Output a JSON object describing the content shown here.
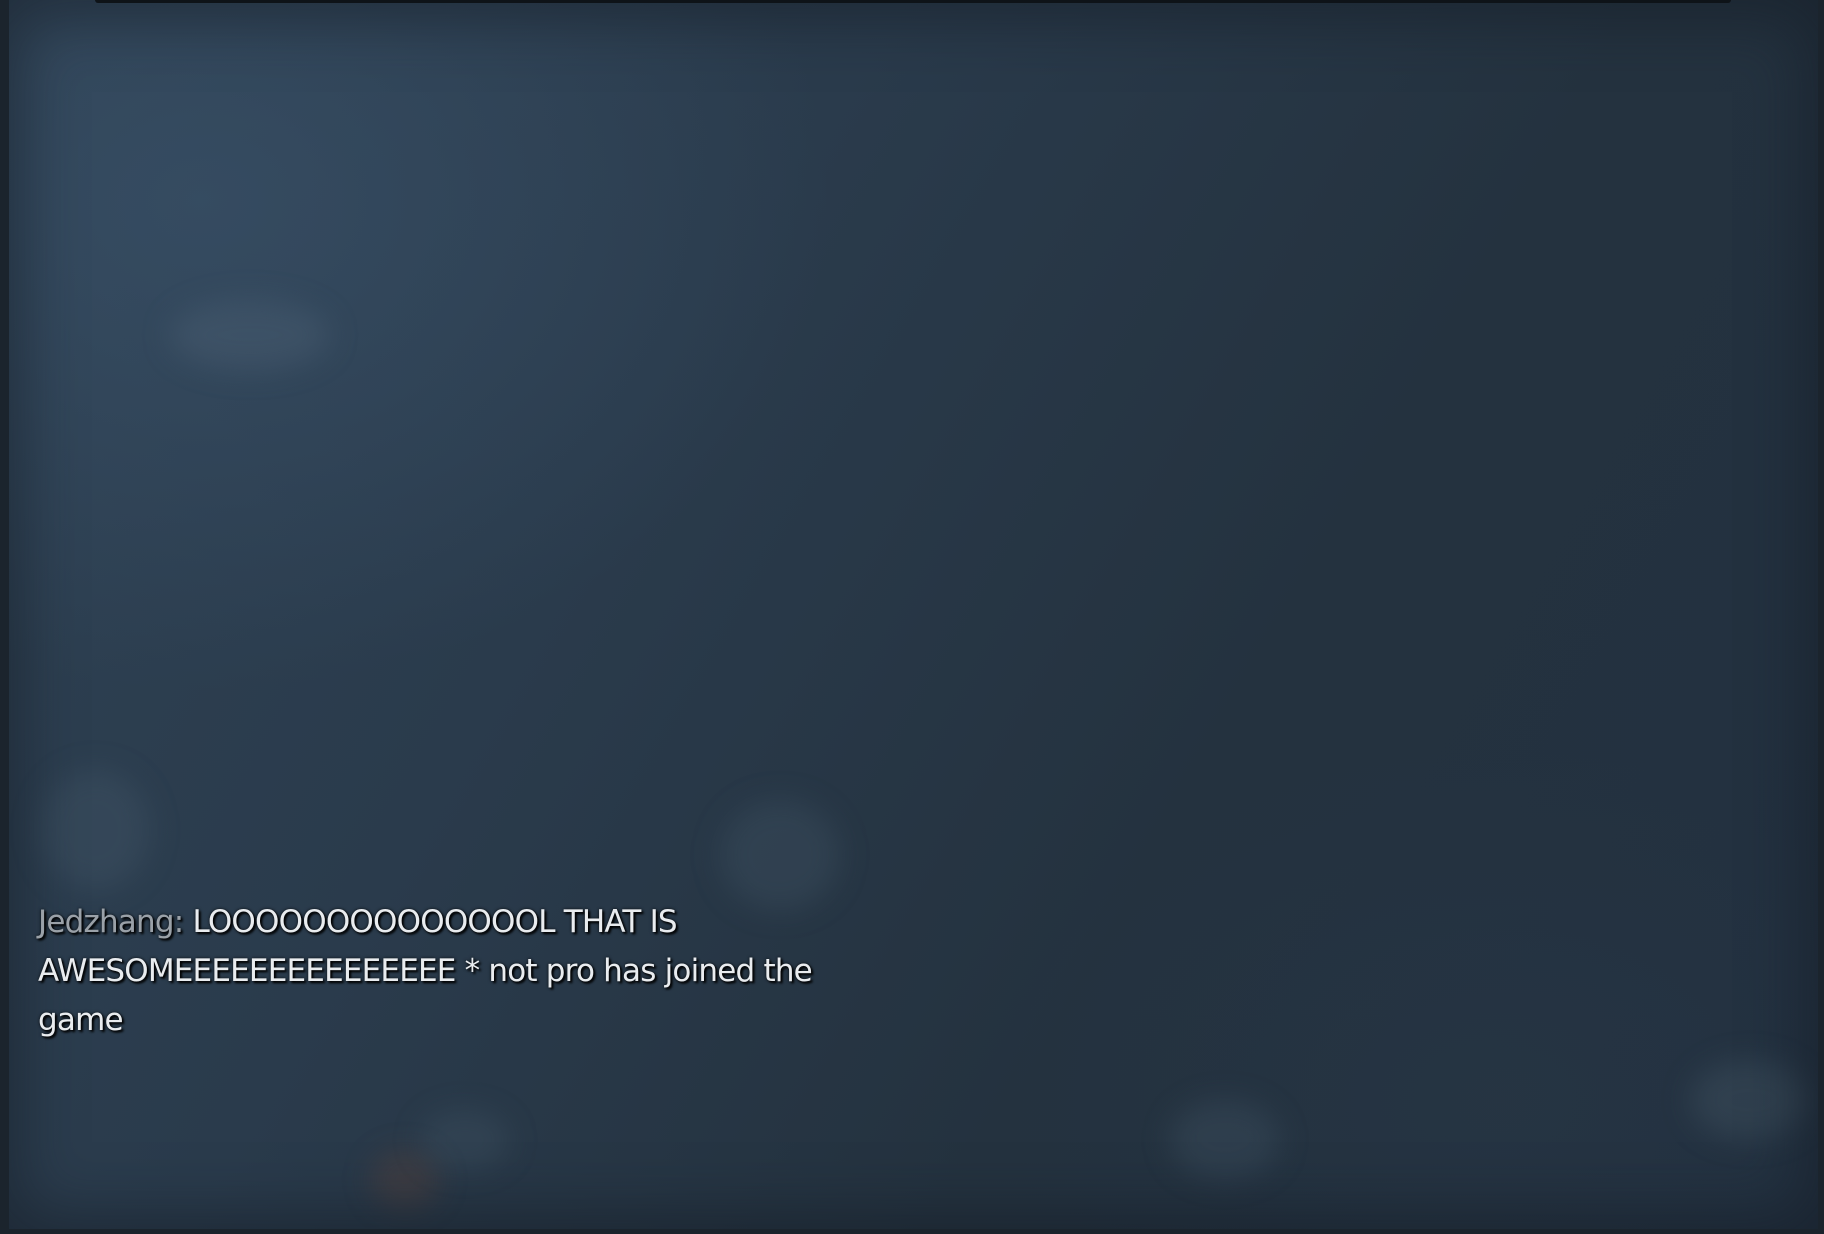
{
  "chat": {
    "messages": [
      {
        "sender": "Jedzhang:",
        "text": "LOOOOOOOOOOOOOOL THAT IS AWESOMEEEEEEEEEEEEEEE * not pro has joined the game"
      }
    ]
  },
  "colors": {
    "sender_name": "#9aa1a8",
    "message_text": "#e9ecef",
    "background": "#2a3b4c"
  }
}
